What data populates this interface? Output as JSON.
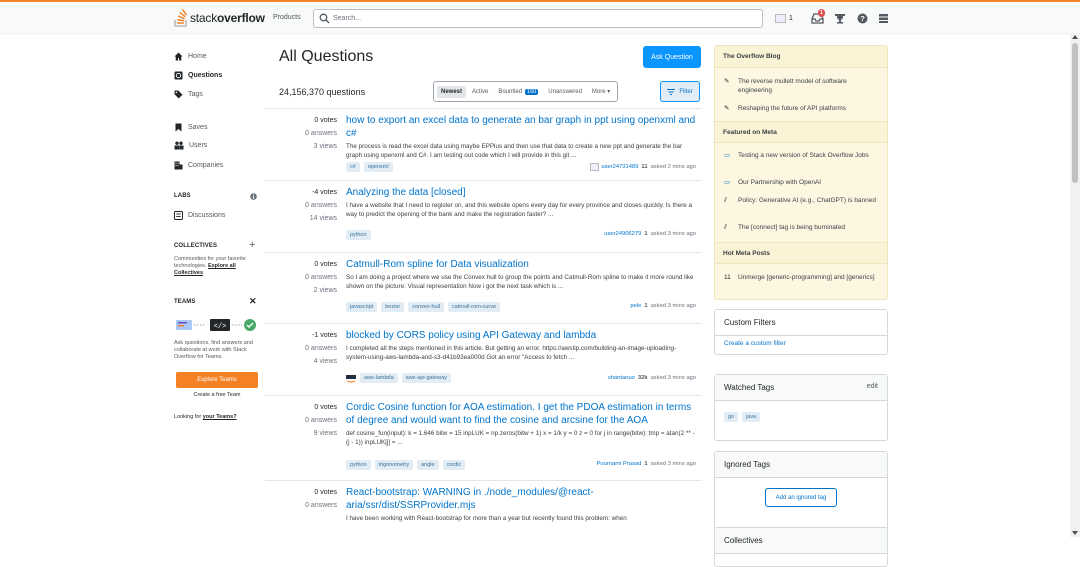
{
  "topbar": {
    "logo_text_1": "stack",
    "logo_text_2": "overflow",
    "products": "Products",
    "search_placeholder": "Search...",
    "reputation": "1",
    "inbox_badge": "1",
    "brand_color": "#f48225"
  },
  "sidebar": {
    "home": "Home",
    "questions": "Questions",
    "tags": "Tags",
    "saves": "Saves",
    "users": "Users",
    "companies": "Companies",
    "labs": "LABS",
    "discussions": "Discussions",
    "collectives": "COLLECTIVES",
    "collectives_text": "Communities for your favorite technologies.",
    "collectives_link": "Explore all Collectives",
    "teams": "TEAMS",
    "teams_text": "Ask questions, find answers and collaborate at work with Stack Overflow for Teams.",
    "explore_teams": "Explore Teams",
    "create_team": "Create a free Team",
    "looking_for": "Looking for",
    "your_teams": "your Teams?"
  },
  "main": {
    "title": "All Questions",
    "ask_button": "Ask Question",
    "count": "24,156,370 questions",
    "tabs": [
      {
        "label": "Newest",
        "selected": true
      },
      {
        "label": "Active"
      },
      {
        "label": "Bountied",
        "count": "160"
      },
      {
        "label": "Unanswered"
      },
      {
        "label": "More ▾"
      }
    ],
    "filter_button": "Filter",
    "questions": [
      {
        "votes": "0 votes",
        "answers": "0 answers",
        "views": "3 views",
        "title": "how to export an excel data to generate an bar graph in ppt using openxml and c#",
        "excerpt": "The process is read the excel data using maybe EPPlus and then use that data to create a new ppt and generate the bar graph using openxml and C#. I am testing out code which I will provide in this git ...",
        "tags": [
          "c#",
          "openxml"
        ],
        "user": "user24731489",
        "rep": "11",
        "time": "asked 2 mins ago",
        "avatar": true
      },
      {
        "votes": "-4 votes",
        "answers": "0 answers",
        "views": "14 views",
        "title": "Analyzing the data [closed]",
        "excerpt": "I have a website that I need to register on, and this website opens every day for every province and closes quickly. Is there a way to predict the opening of the bank and make the registration faster? ...",
        "tags": [
          "python"
        ],
        "user": "user24906279",
        "rep": "1",
        "time": "asked 3 mins ago"
      },
      {
        "votes": "0 votes",
        "answers": "0 answers",
        "views": "2 views",
        "title": "Catmull-Rom spline for Data visualization",
        "excerpt": "So I am doing a project where we use the Convex hull to group the points and Catmull-Rom spline to make it more round like shown on the picture: Visual representation Now i got the next task which is ...",
        "tags": [
          "javascript",
          "bezier",
          "convex-hull",
          "catmull-rom-curve"
        ],
        "user": "pele",
        "rep": "1",
        "time": "asked 3 mins ago"
      },
      {
        "votes": "-1 votes",
        "answers": "0 answers",
        "views": "4 views",
        "title": "blocked by CORS policy using API Gateway and lambda",
        "excerpt": "I completed all the steps mentioned in this article. But getting an error. https://awstip.com/building-an-image-uploading-system-using-aws-lambda-and-s3-d41b93ea000d Got an error \"Access to fetch ...",
        "tags": [
          "aws-lambda",
          "aws-api-gateway"
        ],
        "user": "shantanuo",
        "rep": "32k",
        "time": "asked 3 mins ago",
        "tag_icon": true
      },
      {
        "votes": "0 votes",
        "answers": "0 answers",
        "views": "9 views",
        "title": "Cordic Cosine function for AOA estimation. I get the PDOA estimation in terms of degree and would want to find the cosine and arcsine for the AOA",
        "excerpt": "def cosine_fun(input): k = 1.646 bitw = 15 inpLUK = np.zeros(bitw + 1) x = 1/k y = 0 z = 0 for j in range(bitw): tmp = atan(2 ** -(j - 1)) inpLUK[j] = ...",
        "tags": [
          "python",
          "trigonometry",
          "angle",
          "cordic"
        ],
        "user": "Pournami Prasad",
        "rep": "1",
        "time": "asked 3 mins ago"
      },
      {
        "votes": "0 votes",
        "answers": "0 answers",
        "views": "",
        "title": "React-bootstrap: WARNING in ./node_modules/@react-aria/ssr/dist/SSRProvider.mjs",
        "excerpt": "I have been working with React-bootstrap for more than a year but recently found this problem: when",
        "tags": [],
        "user": "",
        "rep": "",
        "time": ""
      }
    ]
  },
  "right": {
    "blog_title": "The Overflow Blog",
    "blog_items": [
      "The reverse mullett model of software engineering",
      "Reshaping the future of API platforms"
    ],
    "meta_title": "Featured on Meta",
    "meta_items": [
      "Testing a new version of Stack Overflow Jobs",
      "Our Partnership with OpenAI",
      "Policy: Generative AI (e.g., ChatGPT) is banned",
      "The [connect] tag is being burninated"
    ],
    "hot_title": "Hot Meta Posts",
    "hot_count": "11",
    "hot_items": [
      "Unmerge [generic-programming] and [generics]"
    ],
    "custom_filters": "Custom Filters",
    "create_filter": "Create a custom filter",
    "watched_tags": "Watched Tags",
    "edit": "edit",
    "watched": [
      "go",
      "java"
    ],
    "ignored_tags": "Ignored Tags",
    "add_ignored": "Add an ignored tag",
    "collectives": "Collectives"
  }
}
